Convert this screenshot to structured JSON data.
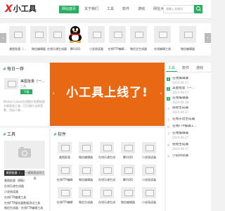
{
  "header": {
    "logo_x": "X",
    "logo_text": "小工具",
    "nav": [
      {
        "label": "网站首页",
        "active": true
      },
      {
        "label": "关于我们",
        "active": false
      },
      {
        "label": "工具",
        "active": false
      },
      {
        "label": "软件",
        "active": false
      },
      {
        "label": "游戏",
        "active": false
      },
      {
        "label": "网址大全",
        "active": false
      },
      {
        "label": "问答",
        "active": false
      }
    ],
    "search_placeholder": "请输入关键词"
  },
  "top_strip": {
    "items": [
      {
        "label": "美图批量（..."
      },
      {
        "label": "微信编辑器"
      },
      {
        "label": "在线乐谱生成器"
      },
      {
        "label": "腾讯QQ"
      },
      {
        "label": "小说阅读器"
      },
      {
        "label": "在线FTP编辑..."
      },
      {
        "label": "微信全生成器"
      },
      {
        "label": "在线编辑工具"
      },
      {
        "label": "微信编辑器"
      }
    ]
  },
  "daily": {
    "title": "每日一荐",
    "name": "美图批量（一...",
    "sub": "工具",
    "button": "下载",
    "desc": "Media Cutout在线图片免费抠图方便高效工具，可为图片去除背景，包括人像..."
  },
  "banner": {
    "text": "小工具上线了!",
    "bg": "#e86813"
  },
  "right_list": {
    "tabs": [
      {
        "label": "工具",
        "active": true
      },
      {
        "label": "软件",
        "active": false
      },
      {
        "label": "游戏",
        "active": false
      }
    ],
    "items": [
      {
        "num": "1",
        "title": "在线编辑器",
        "date": "2024-04-27"
      },
      {
        "num": "2",
        "title": "美图批量（一...",
        "date": "2024-04-27"
      },
      {
        "num": "3",
        "title": "在线编辑器",
        "date": "2024-04-28"
      },
      {
        "num": "4",
        "title": "链接生成器",
        "date": "2024-04-27"
      },
      {
        "num": "5",
        "title": "在线乐谱生成器",
        "date": ""
      },
      {
        "num": "6",
        "title": "在线FTP编辑工...",
        "date": ""
      },
      {
        "num": "7",
        "title": "在线编辑器",
        "date": "2024-04-27"
      },
      {
        "num": "8",
        "title": "链接生成器",
        "date": "2024-04-27"
      },
      {
        "num": "9",
        "title": "小说阅读器",
        "date": ""
      }
    ]
  },
  "tools_section": {
    "title": "工具",
    "tabs": [
      {
        "label": "美图批量（...",
        "active": true
      },
      {
        "label": "一键抠图去除工具",
        "active": false
      }
    ],
    "lines": [
      "美图批量（模板）",
      "在线乐谱生成器",
      "小说阅读器",
      "在线FTP编辑工具",
      "在线FTP服务器数据测试工具",
      "微信生成器 - 在线FTP编辑工具"
    ]
  },
  "software_section": {
    "title": "软件",
    "items": [
      {
        "label": "美图批量"
      },
      {
        "label": "微信编辑器"
      },
      {
        "label": "在线乐谱生成"
      },
      {
        "label": "腾讯QQ"
      },
      {
        "label": "小说阅读器"
      },
      {
        "label": "在线FTP编辑"
      },
      {
        "label": "微信编辑器"
      },
      {
        "label": "在线乐谱生成"
      },
      {
        "label": "腾讯QQ"
      },
      {
        "label": "小说阅读器"
      },
      {
        "label": "在线FTP编辑"
      },
      {
        "label": "微信生成器"
      },
      {
        "label": "在线乐谱生成"
      },
      {
        "label": "微信编辑器"
      },
      {
        "label": "小说阅读器"
      }
    ]
  },
  "colors": {
    "accent": "#27ae60",
    "logo": "#d9262b",
    "banner": "#e86813"
  }
}
